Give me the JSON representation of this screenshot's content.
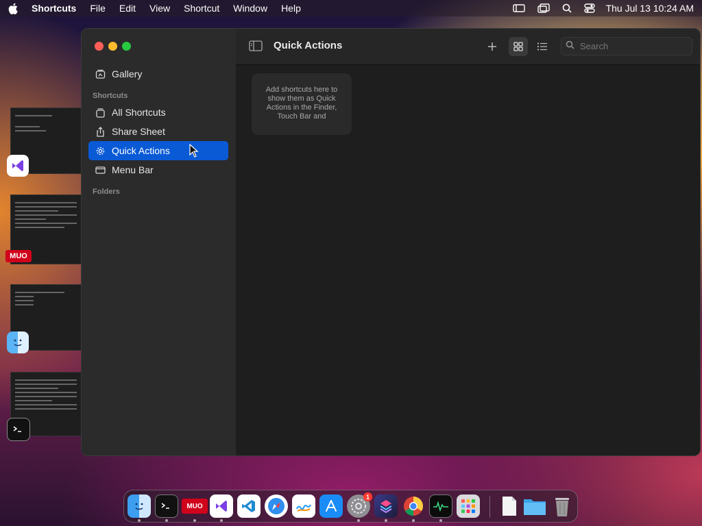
{
  "menubar": {
    "app_name": "Shortcuts",
    "items": [
      "File",
      "Edit",
      "View",
      "Shortcut",
      "Window",
      "Help"
    ],
    "clock": "Thu Jul 13  10:24 AM"
  },
  "window": {
    "sidebar": {
      "gallery_label": "Gallery",
      "shortcuts_section": "Shortcuts",
      "items": [
        {
          "label": "All Shortcuts"
        },
        {
          "label": "Share Sheet"
        },
        {
          "label": "Quick Actions"
        },
        {
          "label": "Menu Bar"
        }
      ],
      "folders_section": "Folders"
    },
    "toolbar": {
      "title": "Quick Actions",
      "search_placeholder": "Search"
    },
    "empty_message": "Add shortcuts here to show them as Quick Actions in the Finder, Touch Bar and"
  },
  "thumbnails": {
    "mud_label": "MUO"
  },
  "dock": {
    "mud_label": "MUO",
    "settings_badge": "1"
  },
  "colors": {
    "selection": "#0a5ad6",
    "sidebar_bg": "#2b2b2b",
    "content_bg": "#1e1e1e"
  }
}
